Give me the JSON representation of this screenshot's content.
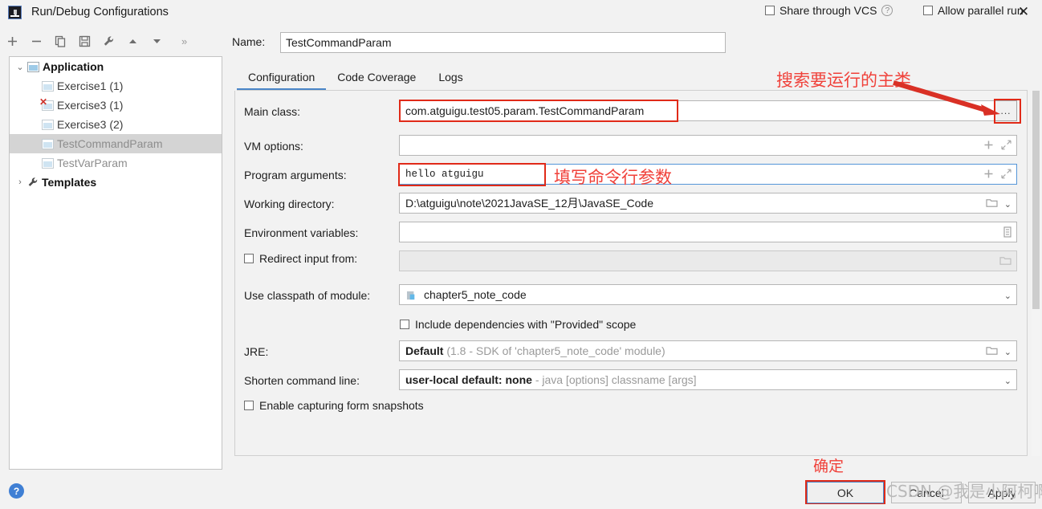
{
  "window": {
    "title": "Run/Debug Configurations",
    "app_icon": "intellij-idea-icon",
    "close_icon": "✕"
  },
  "toolbar": {
    "add": "+",
    "remove": "−",
    "copy": "copy-icon",
    "save": "save-icon",
    "edit_templates": "wrench-icon",
    "move_up": "▲",
    "move_down": "▼",
    "more": "»"
  },
  "tree": {
    "nodes": [
      {
        "label": "Application",
        "bold": true,
        "twisty": "⌄",
        "icon": "application-icon",
        "selected": false,
        "error": false,
        "indent": 0
      },
      {
        "label": "Exercise1 (1)",
        "bold": false,
        "twisty": "",
        "icon": "config-icon",
        "selected": false,
        "error": false,
        "indent": 1
      },
      {
        "label": "Exercise3 (1)",
        "bold": false,
        "twisty": "",
        "icon": "config-icon",
        "selected": false,
        "error": true,
        "indent": 1
      },
      {
        "label": "Exercise3 (2)",
        "bold": false,
        "twisty": "",
        "icon": "config-icon",
        "selected": false,
        "error": false,
        "indent": 1
      },
      {
        "label": "TestCommandParam",
        "bold": false,
        "twisty": "",
        "icon": "config-icon",
        "selected": true,
        "error": false,
        "indent": 1
      },
      {
        "label": "TestVarParam",
        "bold": false,
        "twisty": "",
        "icon": "config-icon",
        "selected": false,
        "error": false,
        "indent": 1
      },
      {
        "label": "Templates",
        "bold": true,
        "twisty": "›",
        "icon": "wrench-icon",
        "selected": false,
        "error": false,
        "indent": 0
      }
    ]
  },
  "name_row": {
    "label": "Name:",
    "value": "TestCommandParam",
    "share_vcs_label": "Share through VCS",
    "share_vcs_checked": false,
    "help_icon": "?",
    "allow_parallel_label": "Allow parallel run",
    "allow_parallel_checked": false
  },
  "tabs": [
    {
      "label": "Configuration",
      "active": true
    },
    {
      "label": "Code Coverage",
      "active": false
    },
    {
      "label": "Logs",
      "active": false
    }
  ],
  "fields": {
    "main_class": {
      "label": "Main class:",
      "value": "com.atguigu.test05.param.TestCommandParam",
      "browse": "..."
    },
    "vm_options": {
      "label": "VM options:",
      "value": ""
    },
    "program_arguments": {
      "label": "Program arguments:",
      "value": "hello atguigu"
    },
    "working_directory": {
      "label": "Working directory:",
      "value": "D:\\atguigu\\note\\2021JavaSE_12月\\JavaSE_Code"
    },
    "environment_variables": {
      "label": "Environment variables:",
      "value": ""
    },
    "redirect_input": {
      "label": "Redirect input from:",
      "checked": false,
      "value": ""
    },
    "use_classpath": {
      "label": "Use classpath of module:",
      "value": "chapter5_note_code"
    },
    "include_provided": {
      "label": "Include dependencies with \"Provided\" scope",
      "checked": false
    },
    "jre": {
      "label": "JRE:",
      "value_bold": "Default",
      "value_dim": "(1.8 - SDK of 'chapter5_note_code' module)"
    },
    "shorten_cmd": {
      "label": "Shorten command line:",
      "value_bold": "user-local default: none",
      "value_dim": "- java [options] classname [args]"
    },
    "form_snapshots": {
      "label": "Enable capturing form snapshots",
      "checked": false
    }
  },
  "annotations": {
    "main_class_note": "搜索要运行的主类",
    "program_args_note": "填写命令行参数",
    "ok_note": "确定",
    "color": "#f0413a"
  },
  "footer": {
    "help": "?",
    "ok": "OK",
    "cancel": "Cancel",
    "apply": "Apply",
    "watermark": "CSDN @我是小阿柯啊"
  }
}
